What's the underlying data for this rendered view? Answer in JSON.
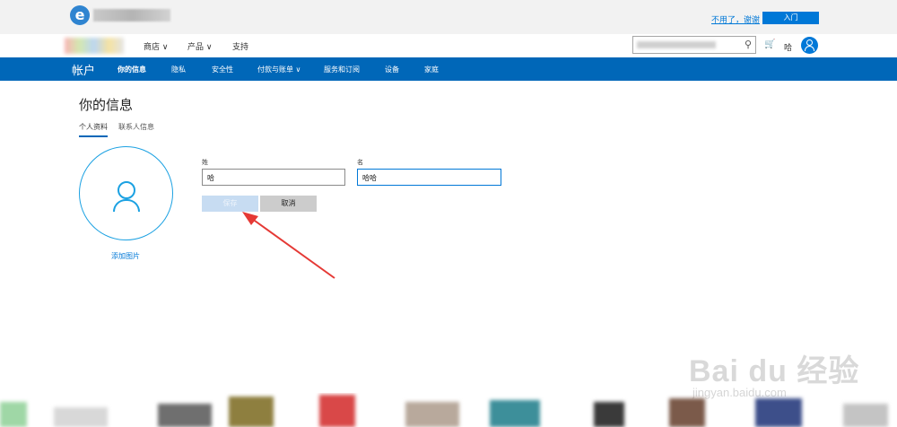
{
  "browser": {
    "feedback_link": "不用了，谢谢",
    "signin_button": "入门"
  },
  "header": {
    "nav": [
      {
        "label": "商店 ∨"
      },
      {
        "label": "产品 ∨"
      },
      {
        "label": "支持"
      }
    ],
    "user_name": "哈"
  },
  "account_bar": {
    "title": "帐户",
    "tabs": [
      {
        "label": "你的信息"
      },
      {
        "label": "隐私"
      },
      {
        "label": "安全性"
      },
      {
        "label": "付款与账单 ∨"
      },
      {
        "label": "服务和订阅"
      },
      {
        "label": "设备"
      },
      {
        "label": "家庭"
      }
    ]
  },
  "page": {
    "title": "你的信息",
    "subtabs": [
      {
        "label": "个人资料"
      },
      {
        "label": "联系人信息"
      }
    ],
    "add_photo": "添加图片",
    "last_name_label": "姓",
    "last_name_value": "哈",
    "first_name_label": "名",
    "first_name_value": "哈哈",
    "save_button": "保存",
    "cancel_button": "取消"
  },
  "watermark": {
    "text": "Bai du 经验",
    "sub": "jingyan.baidu.com"
  },
  "colors": {
    "brand_blue": "#0067b8",
    "accent": "#0078d7",
    "avatar_ring": "#1ba1e2",
    "arrow": "#e53935"
  }
}
